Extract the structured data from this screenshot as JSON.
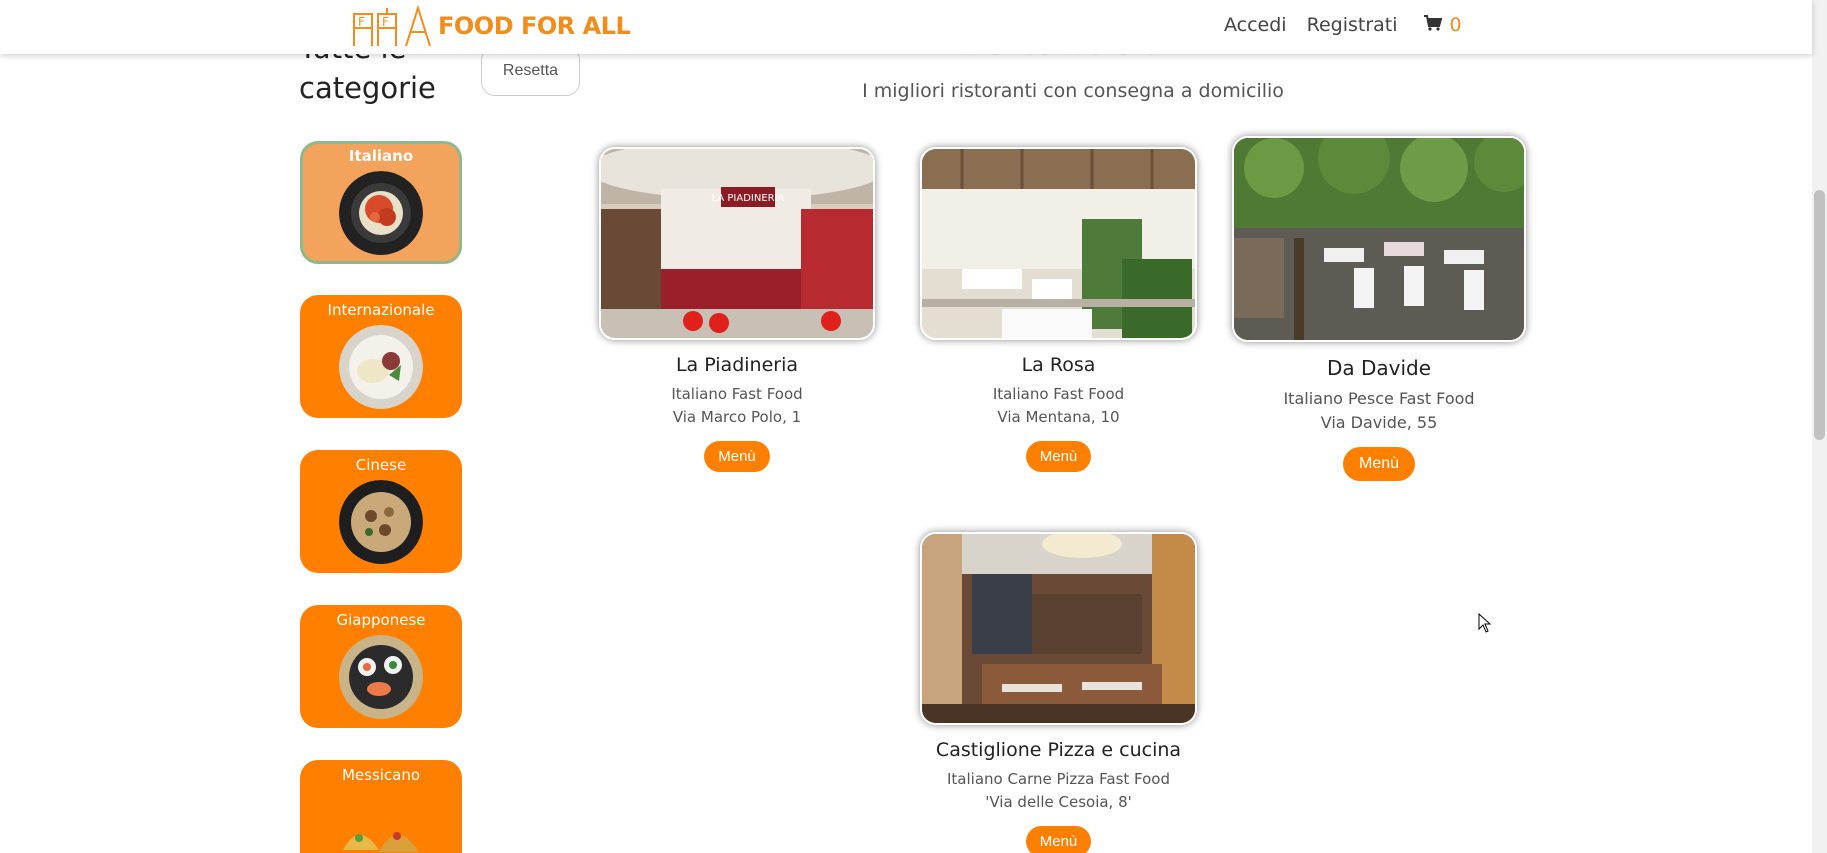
{
  "header": {
    "logo_text": "FOOD FOR ALL",
    "login": "Accedi",
    "register": "Registrati",
    "cart_count": "0"
  },
  "sidebar": {
    "title": "Tutte le categorie",
    "reset": "Resetta",
    "categories": [
      {
        "label": "Italiano",
        "active": true
      },
      {
        "label": "Internazionale"
      },
      {
        "label": "Cinese"
      },
      {
        "label": "Giapponese"
      },
      {
        "label": "Messicano"
      }
    ]
  },
  "main": {
    "heading": "Elenco Ristoranti",
    "subtitle": "I migliori ristoranti con consegna a domicilio",
    "restaurants": [
      {
        "name": "La Piadineria",
        "tags": "Italiano Fast Food",
        "address": "Via Marco Polo, 1",
        "button": "Menù"
      },
      {
        "name": "La Rosa",
        "tags": "Italiano Fast Food",
        "address": "Via Mentana, 10",
        "button": "Menù"
      },
      {
        "name": "Da Davide",
        "tags": "Italiano Pesce Fast Food",
        "address": "Via Davide, 55",
        "button": "Menù"
      },
      {
        "name": "Castiglione Pizza e cucina",
        "tags": "Italiano Carne Pizza Fast Food",
        "address": "'Via delle Cesoia, 8'",
        "button": "Menù"
      }
    ]
  },
  "colors": {
    "accent": "#ff8000",
    "logo": "#f28c1c"
  }
}
